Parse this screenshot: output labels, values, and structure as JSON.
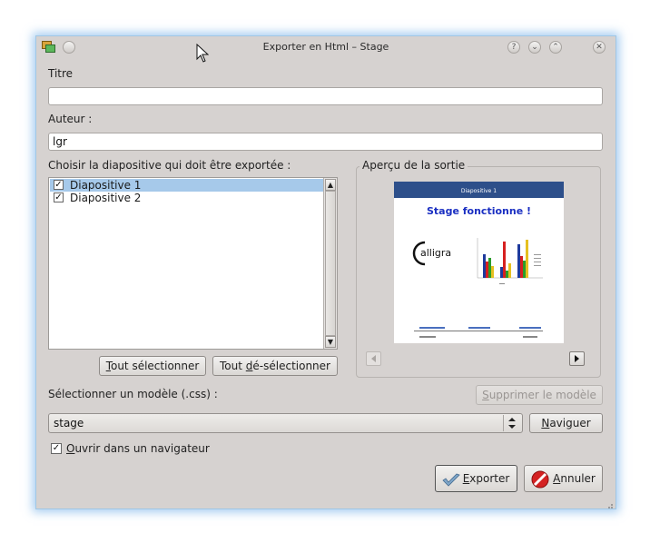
{
  "window": {
    "title": "Exporter en Html – Stage",
    "controls": {
      "help": "?",
      "minimize": "⌄",
      "maximize": "⌃",
      "close": "✕"
    }
  },
  "form": {
    "title_label": "Titre",
    "title_value": "",
    "author_label": "Auteur :",
    "author_value": "lgr",
    "slides_label": "Choisir la diapositive qui doit être exportée :",
    "slides": [
      {
        "label": "Diapositive 1",
        "checked": true,
        "selected": true
      },
      {
        "label": "Diapositive 2",
        "checked": true,
        "selected": false
      }
    ],
    "select_all_pre": "",
    "select_all_u": "T",
    "select_all_post": "out sélectionner",
    "deselect_all_pre": "Tout ",
    "deselect_all_u": "d",
    "deselect_all_post": "é-sélectionner",
    "preview_label": "Aperçu de la sortie",
    "template_label": "Sélectionner un modèle (.css) :",
    "delete_template_pre": "",
    "delete_template_u": "S",
    "delete_template_post": "upprimer le modèle",
    "template_value": "stage",
    "browse_pre": "",
    "browse_u": "N",
    "browse_post": "aviguer",
    "open_browser_pre": "",
    "open_browser_u": "O",
    "open_browser_post": "uvrir dans un navigateur",
    "open_browser_checked": true,
    "export_pre": "",
    "export_u": "E",
    "export_post": "xporter",
    "cancel_pre": "",
    "cancel_u": "A",
    "cancel_post": "nnuler"
  },
  "preview": {
    "header": "Diapositive 1",
    "slide_title": "Stage fonctionne !",
    "logo_text": "calligra"
  },
  "colors": {
    "window_bg": "#d6d2d0",
    "selection": "#a6c9ea",
    "preview_header": "#2d4f8a",
    "preview_title": "#1a2fc2"
  }
}
